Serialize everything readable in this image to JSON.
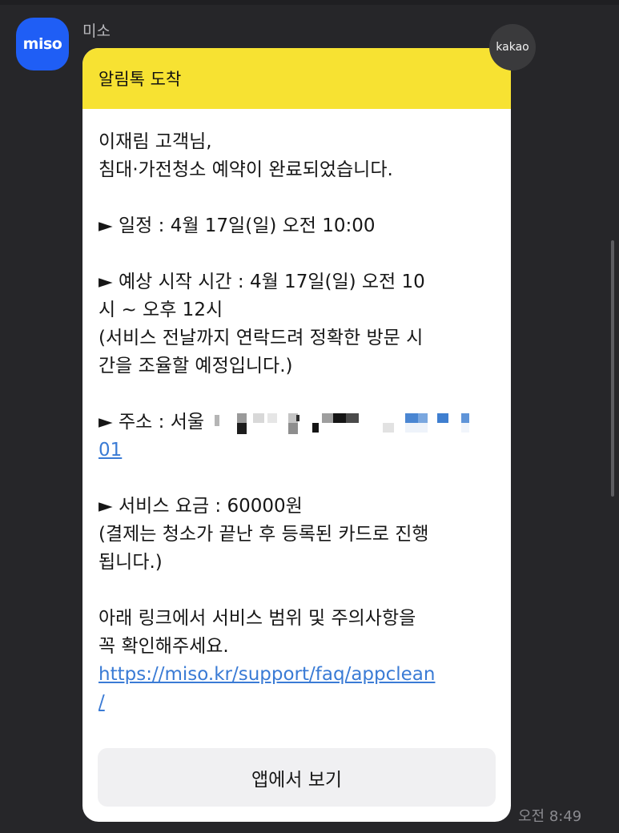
{
  "chat": {
    "sender_name": "미소",
    "avatar_label": "miso",
    "channel_badge": "kakao",
    "time": "오전 8:49"
  },
  "message": {
    "header": "알림톡 도착",
    "greeting": "이재림 고객님,",
    "confirmation": "침대·가전청소 예약이 완료되었습니다.",
    "schedule": "► 일정 : 4월 17일(일) 오전 10:00",
    "start_time_line1": "► 예상 시작 시간 : 4월 17일(일) 오전 10",
    "start_time_line2": "시 ~ 오후 12시",
    "start_note_line1": "(서비스 전날까지 연락드려 정확한 방문 시",
    "start_note_line2": "간을 조율할 예정입니다.)",
    "address_prefix": "► 주소 : 서울",
    "address_suffix": "01",
    "fee": "► 서비스 요금 : 60000원",
    "fee_note_line1": "(결제는 청소가 끝난 후 등록된 카드로 진행",
    "fee_note_line2": "됩니다.)",
    "info_line1": "아래 링크에서 서비스 범위 및 주의사항을",
    "info_line2": "꼭 확인해주세요.",
    "link_line1": "https://miso.kr/support/faq/appclean",
    "link_line2": "/",
    "button_label": "앱에서 보기"
  },
  "colors": {
    "background": "#262629",
    "header_yellow": "#f7e232",
    "avatar_blue": "#1f5ef5",
    "link_blue": "#3a7bd5"
  }
}
